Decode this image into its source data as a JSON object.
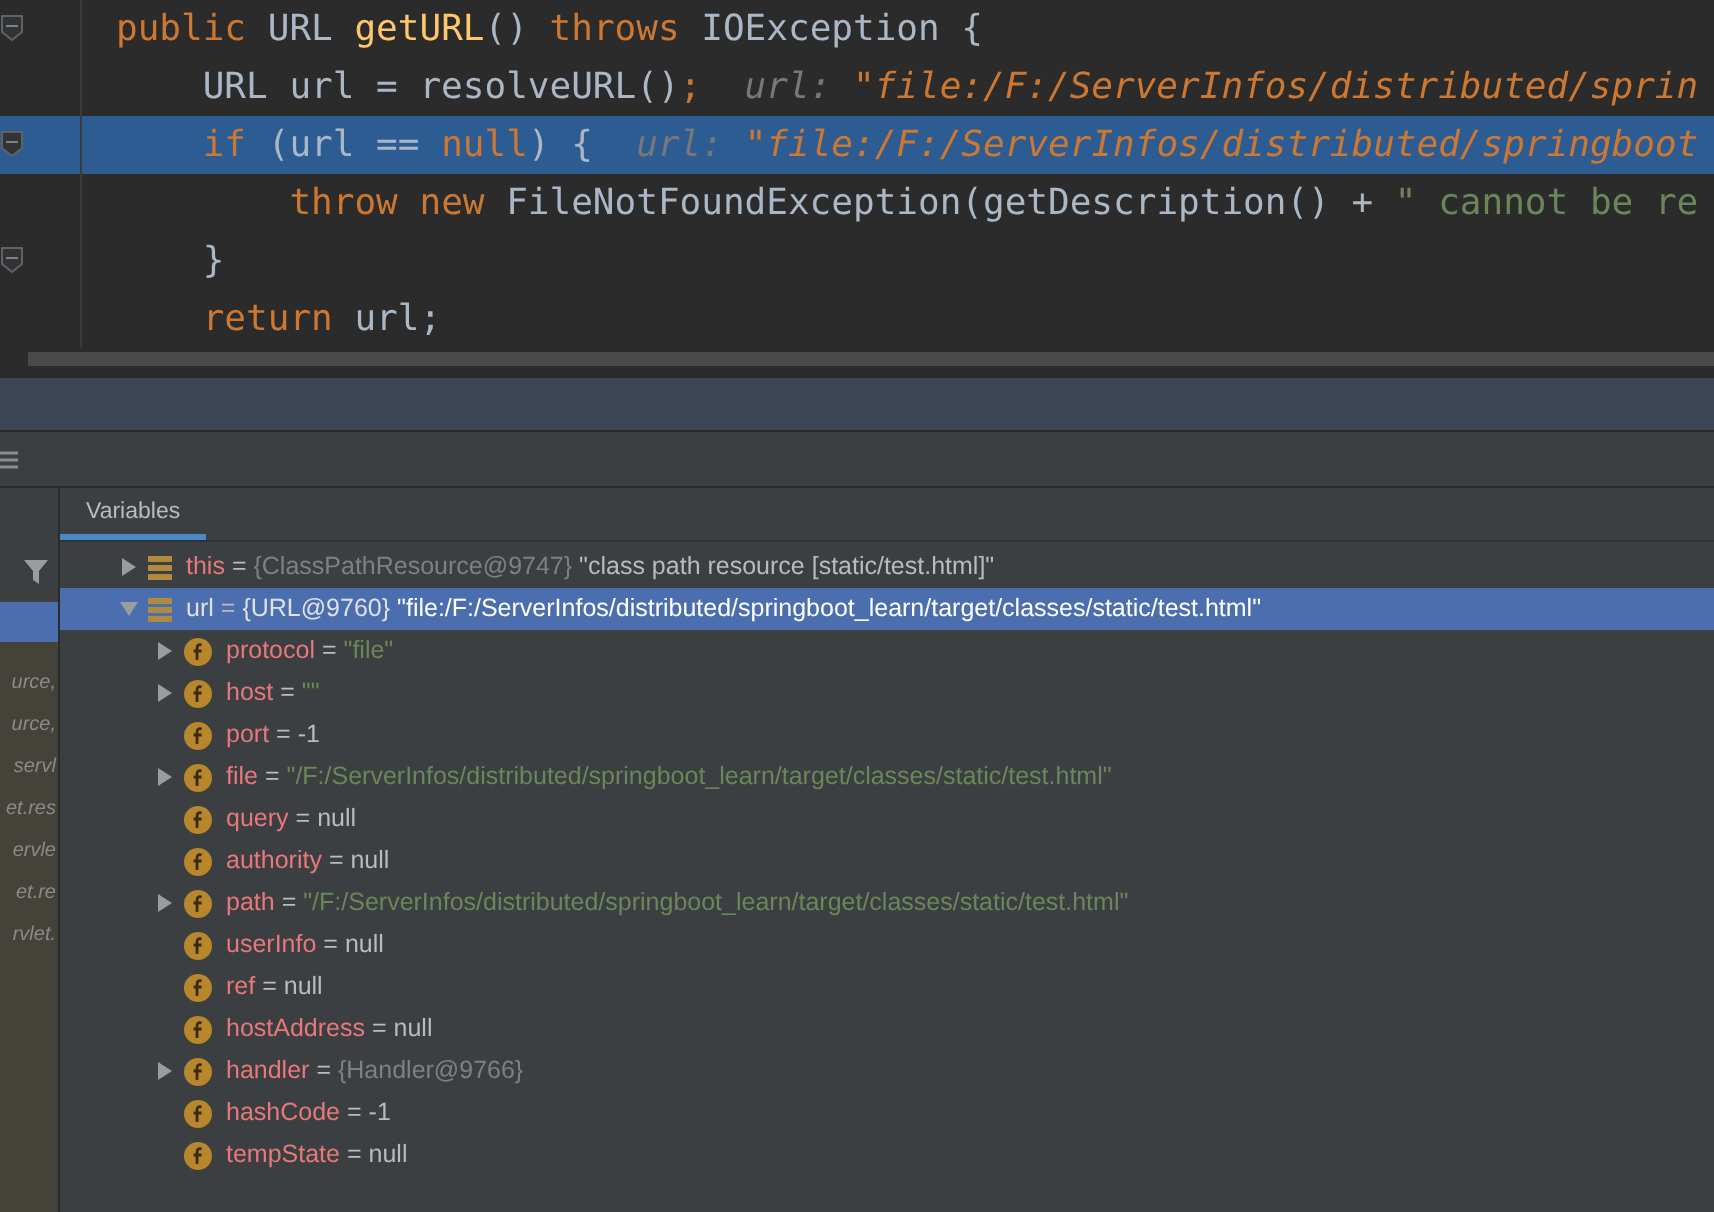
{
  "editor": {
    "lines": [
      {
        "highlighted": false,
        "fold": true,
        "tokens": [
          {
            "kind": "keyword",
            "text": "public"
          },
          {
            "kind": "plain",
            "text": " URL "
          },
          {
            "kind": "method",
            "text": "getURL"
          },
          {
            "kind": "plain",
            "text": "() "
          },
          {
            "kind": "keyword",
            "text": "throws"
          },
          {
            "kind": "plain",
            "text": " IOException {"
          }
        ]
      },
      {
        "highlighted": false,
        "fold": false,
        "tokens": [
          {
            "kind": "plain",
            "text": "    URL url = resolveURL()"
          },
          {
            "kind": "keyword",
            "text": ";"
          },
          {
            "kind": "hint",
            "text": "  url: "
          },
          {
            "kind": "hintvalue",
            "text": "\"file:/F:/ServerInfos/distributed/sprin"
          }
        ]
      },
      {
        "highlighted": true,
        "fold": true,
        "tokens": [
          {
            "kind": "keyword",
            "text": "    if"
          },
          {
            "kind": "plain",
            "text": " (url == "
          },
          {
            "kind": "keyword",
            "text": "null"
          },
          {
            "kind": "plain",
            "text": ") {"
          },
          {
            "kind": "hint",
            "text": "  url: "
          },
          {
            "kind": "hintvalue",
            "text": "\"file:/F:/ServerInfos/distributed/springboot"
          }
        ]
      },
      {
        "highlighted": false,
        "fold": false,
        "tokens": [
          {
            "kind": "keyword",
            "text": "        throw"
          },
          {
            "kind": "keyword",
            "text": " new"
          },
          {
            "kind": "plain",
            "text": " FileNotFoundException(getDescription() + "
          },
          {
            "kind": "string",
            "text": "\" cannot be re"
          }
        ]
      },
      {
        "highlighted": false,
        "fold": true,
        "tokens": [
          {
            "kind": "plain",
            "text": "    }"
          }
        ]
      },
      {
        "highlighted": false,
        "fold": false,
        "tokens": [
          {
            "kind": "keyword",
            "text": "    return"
          },
          {
            "kind": "plain",
            "text": " url;"
          }
        ]
      }
    ]
  },
  "frames": {
    "items": [
      {
        "text": "urce,",
        "selected": false
      },
      {
        "text": "urce,",
        "selected": false
      },
      {
        "text": "servl",
        "selected": false
      },
      {
        "text": "et.res",
        "selected": false
      },
      {
        "text": "ervle",
        "selected": false
      },
      {
        "text": "et.re",
        "selected": false
      },
      {
        "text": "rvlet.",
        "selected": false
      }
    ]
  },
  "variables": {
    "tab": "Variables",
    "nodes": [
      {
        "kind": "object",
        "name": "this",
        "operator": "=",
        "type": "{ClassPathResource@9747}",
        "value": {
          "kind": "plain",
          "text": "\"class path resource [static/test.html]\""
        },
        "expandable": true,
        "expanded": false,
        "selected": false
      },
      {
        "kind": "object",
        "name": "url",
        "operator": "=",
        "type": "{URL@9760}",
        "value": {
          "kind": "plain",
          "text": "\"file:/F:/ServerInfos/distributed/springboot_learn/target/classes/static/test.html\""
        },
        "expandable": true,
        "expanded": true,
        "selected": true,
        "children": [
          {
            "kind": "field",
            "name": "protocol",
            "operator": "=",
            "value": {
              "kind": "string",
              "text": "\"file\""
            },
            "expandable": true,
            "expanded": false,
            "selected": false
          },
          {
            "kind": "field",
            "name": "host",
            "operator": "=",
            "value": {
              "kind": "string",
              "text": "\"\""
            },
            "expandable": true,
            "expanded": false,
            "selected": false
          },
          {
            "kind": "field",
            "name": "port",
            "operator": "=",
            "value": {
              "kind": "plain",
              "text": "-1"
            },
            "expandable": false,
            "selected": false
          },
          {
            "kind": "field",
            "name": "file",
            "operator": "=",
            "value": {
              "kind": "string",
              "text": "\"/F:/ServerInfos/distributed/springboot_learn/target/classes/static/test.html\""
            },
            "expandable": true,
            "expanded": false,
            "selected": false
          },
          {
            "kind": "field",
            "name": "query",
            "operator": "=",
            "value": {
              "kind": "plain",
              "text": "null"
            },
            "expandable": false,
            "selected": false
          },
          {
            "kind": "field",
            "name": "authority",
            "operator": "=",
            "value": {
              "kind": "plain",
              "text": "null"
            },
            "expandable": false,
            "selected": false
          },
          {
            "kind": "field",
            "name": "path",
            "operator": "=",
            "value": {
              "kind": "string",
              "text": "\"/F:/ServerInfos/distributed/springboot_learn/target/classes/static/test.html\""
            },
            "expandable": true,
            "expanded": false,
            "selected": false
          },
          {
            "kind": "field",
            "name": "userInfo",
            "operator": "=",
            "value": {
              "kind": "plain",
              "text": "null"
            },
            "expandable": false,
            "selected": false
          },
          {
            "kind": "field",
            "name": "ref",
            "operator": "=",
            "value": {
              "kind": "plain",
              "text": "null"
            },
            "expandable": false,
            "selected": false
          },
          {
            "kind": "field",
            "name": "hostAddress",
            "operator": "=",
            "value": {
              "kind": "plain",
              "text": "null"
            },
            "expandable": false,
            "selected": false
          },
          {
            "kind": "field",
            "name": "handler",
            "operator": "=",
            "type": "{Handler@9766}",
            "expandable": true,
            "expanded": false,
            "selected": false
          },
          {
            "kind": "field",
            "name": "hashCode",
            "operator": "=",
            "value": {
              "kind": "plain",
              "text": "-1"
            },
            "expandable": false,
            "selected": false
          },
          {
            "kind": "field",
            "name": "tempState",
            "operator": "=",
            "value": {
              "kind": "plain",
              "text": "null"
            },
            "expandable": false,
            "selected": false
          }
        ]
      }
    ]
  }
}
